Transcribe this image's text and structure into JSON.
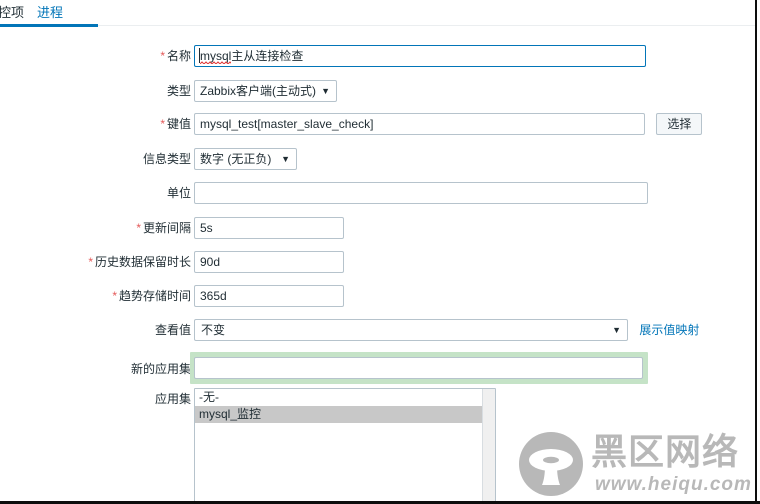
{
  "tabs": [
    {
      "label": "监控项",
      "active": true
    },
    {
      "label": "进程",
      "active": false
    }
  ],
  "form": {
    "name": {
      "label": "名称",
      "required": "*",
      "value": "mysql主从连接检查",
      "placeholder": ""
    },
    "type": {
      "label": "类型",
      "required": "",
      "value": "Zabbix客户端(主动式)"
    },
    "key": {
      "label": "键值",
      "required": "*",
      "value": "mysql_test[master_slave_check]",
      "placeholder": "",
      "select_button": "选择"
    },
    "value_type": {
      "label": "信息类型",
      "required": "",
      "value": "数字 (无正负)"
    },
    "units": {
      "label": "单位",
      "required": "",
      "value": "",
      "placeholder": ""
    },
    "update_interval": {
      "label": "更新间隔",
      "required": "*",
      "value": "5s",
      "placeholder": ""
    },
    "history": {
      "label": "历史数据保留时长",
      "required": "*",
      "value": "90d",
      "placeholder": ""
    },
    "trends": {
      "label": "趋势存储时间",
      "required": "*",
      "value": "365d",
      "placeholder": ""
    },
    "show_value": {
      "label": "查看值",
      "required": "",
      "value": "不变",
      "link": "展示值映射"
    },
    "new_application": {
      "label": "新的应用集",
      "required": "",
      "value": "",
      "placeholder": ""
    },
    "applications": {
      "label": "应用集",
      "required": "",
      "options": [
        {
          "label": "-无-",
          "selected": false
        },
        {
          "label": "mysql_监控",
          "selected": true
        }
      ]
    }
  },
  "watermark": {
    "text": "黑区网络",
    "url": "www.heiqu.com"
  },
  "colors": {
    "accent": "#0275b8",
    "required": "#e45959",
    "field_border": "#b6c3cc",
    "green_highlight": "#c5e3c7",
    "selected_option": "#c8c8c8"
  }
}
